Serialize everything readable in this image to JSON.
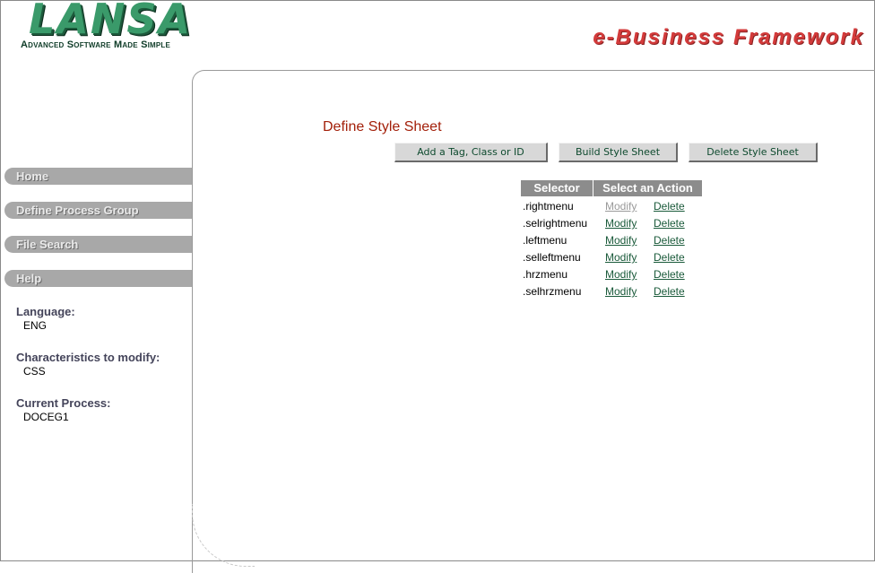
{
  "header": {
    "logo_word": "LANSA",
    "logo_tagline": "Advanced Software Made Simple",
    "product_title": "e-Business Framework"
  },
  "sidebar": {
    "items": [
      {
        "label": "Home"
      },
      {
        "label": "Define Process Group"
      },
      {
        "label": "File Search"
      },
      {
        "label": "Help"
      }
    ],
    "info": [
      {
        "label": "Language:",
        "value": "ENG"
      },
      {
        "label": "Characteristics to modify:",
        "value": "CSS"
      },
      {
        "label": "Current Process:",
        "value": "DOCEG1"
      }
    ]
  },
  "main": {
    "title": "Define Style Sheet",
    "buttons": {
      "add": "Add a Tag, Class or ID",
      "build": "Build Style Sheet",
      "delete": "Delete Style Sheet"
    },
    "table": {
      "headers": [
        "Selector",
        "Select an Action"
      ],
      "rows": [
        {
          "selector": ".rightmenu",
          "modify": "Modify",
          "delete": "Delete",
          "modify_state": "visited"
        },
        {
          "selector": ".selrightmenu",
          "modify": "Modify",
          "delete": "Delete"
        },
        {
          "selector": ".leftmenu",
          "modify": "Modify",
          "delete": "Delete"
        },
        {
          "selector": ".selleftmenu",
          "modify": "Modify",
          "delete": "Delete"
        },
        {
          "selector": ".hrzmenu",
          "modify": "Modify",
          "delete": "Delete"
        },
        {
          "selector": ".selhrzmenu",
          "modify": "Modify",
          "delete": "Delete"
        }
      ]
    }
  },
  "colors": {
    "title": "#a3200a",
    "link": "#1a5a3a",
    "link_visited": "#9a9a9a",
    "nav_bg": "#a8a8a8",
    "table_header": "#8c8c8c",
    "brand_red": "#d33b3b",
    "brand_green": "#3a9a6a"
  }
}
